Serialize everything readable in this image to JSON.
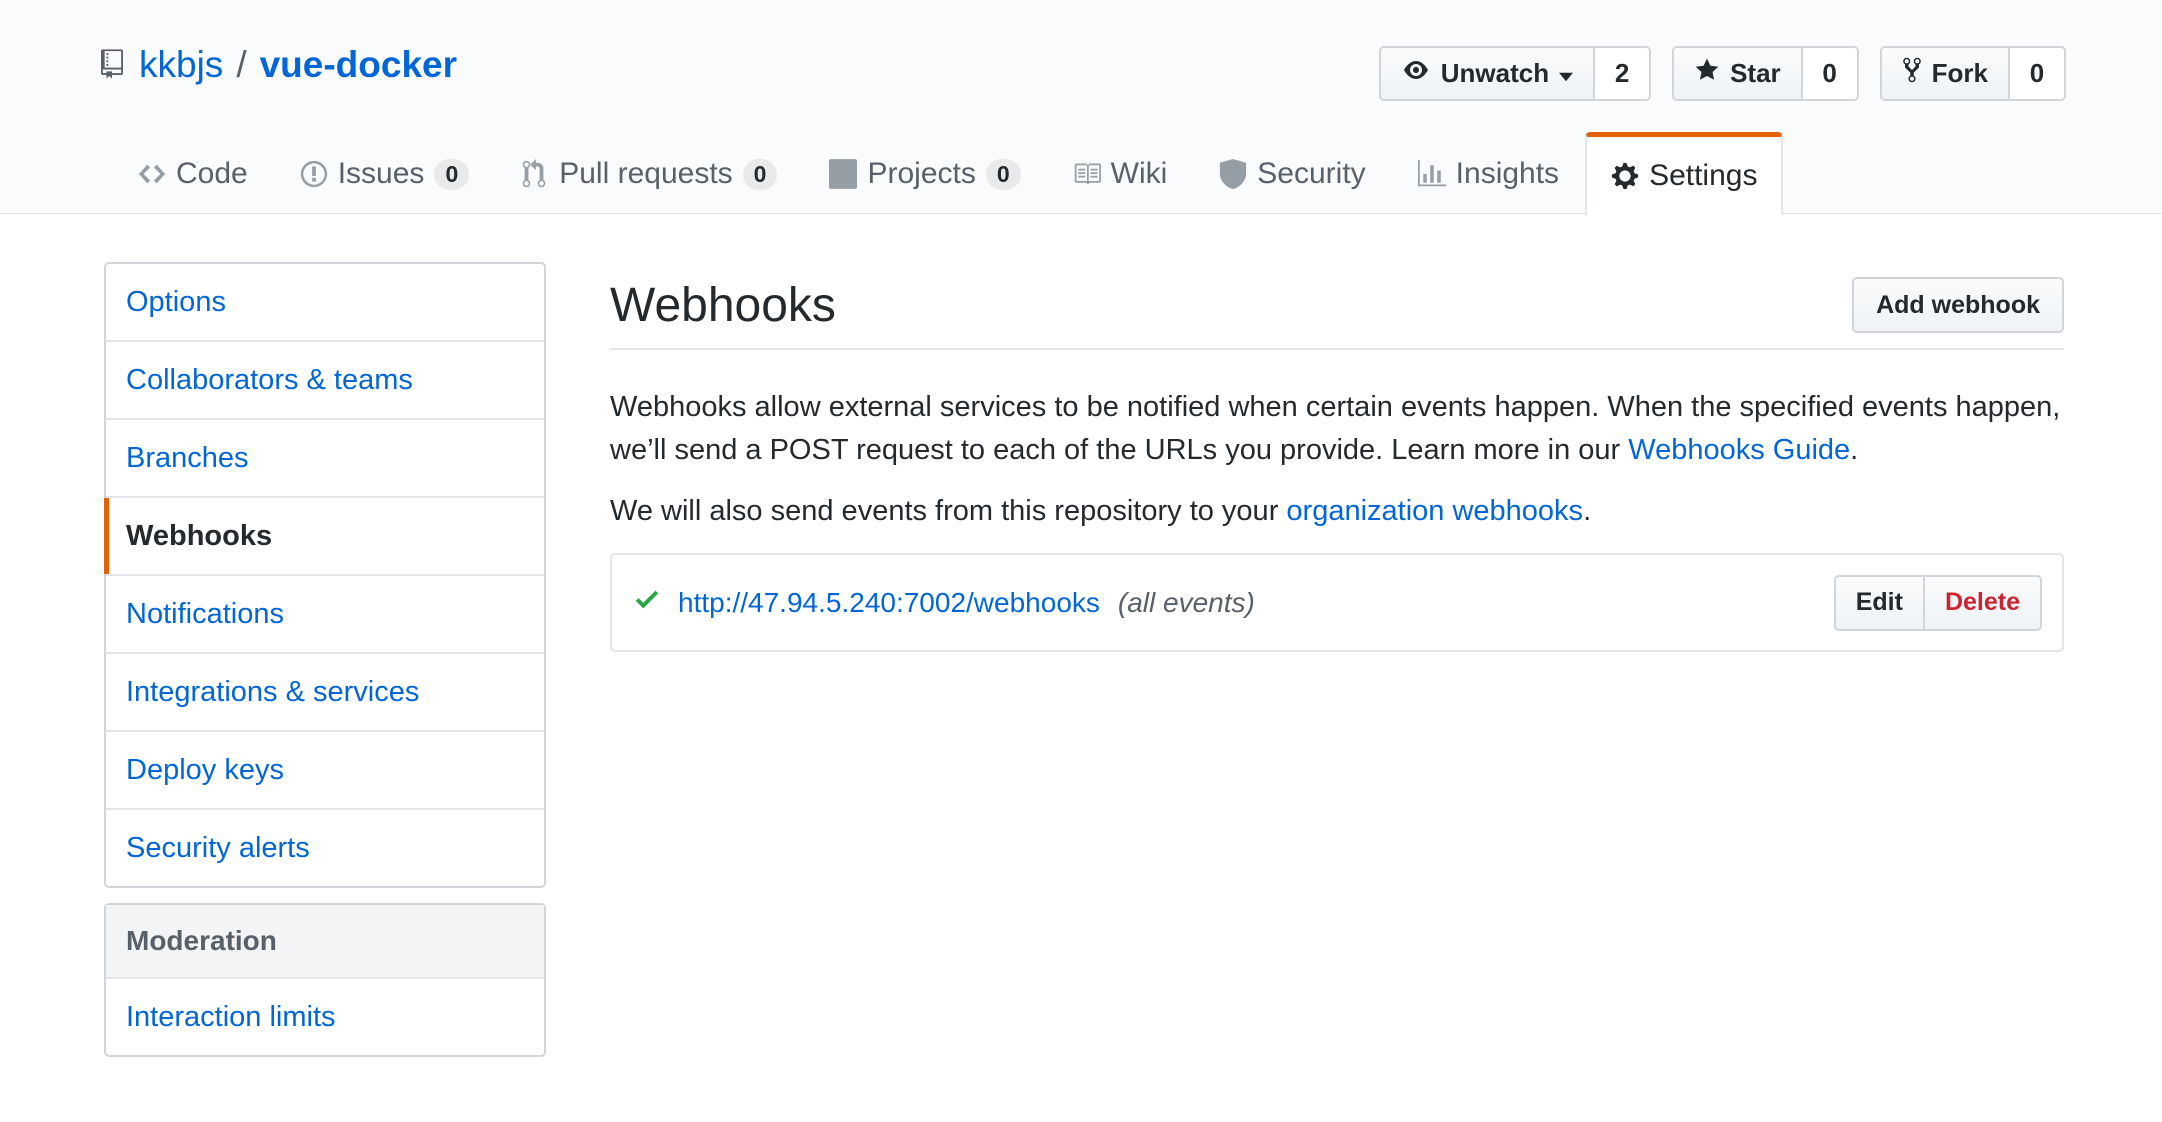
{
  "repo": {
    "owner": "kkbjs",
    "separator": "/",
    "name": "vue-docker"
  },
  "actions": {
    "watch": {
      "label": "Unwatch",
      "count": "2"
    },
    "star": {
      "label": "Star",
      "count": "0"
    },
    "fork": {
      "label": "Fork",
      "count": "0"
    }
  },
  "tabs": [
    {
      "label": "Code",
      "counter": ""
    },
    {
      "label": "Issues",
      "counter": "0"
    },
    {
      "label": "Pull requests",
      "counter": "0"
    },
    {
      "label": "Projects",
      "counter": "0"
    },
    {
      "label": "Wiki",
      "counter": ""
    },
    {
      "label": "Security",
      "counter": ""
    },
    {
      "label": "Insights",
      "counter": ""
    },
    {
      "label": "Settings",
      "counter": "",
      "selected": true
    }
  ],
  "sidebar": {
    "items": [
      {
        "label": "Options"
      },
      {
        "label": "Collaborators & teams"
      },
      {
        "label": "Branches"
      },
      {
        "label": "Webhooks",
        "selected": true
      },
      {
        "label": "Notifications"
      },
      {
        "label": "Integrations & services"
      },
      {
        "label": "Deploy keys"
      },
      {
        "label": "Security alerts"
      }
    ],
    "moderation": {
      "heading": "Moderation",
      "items": [
        {
          "label": "Interaction limits"
        }
      ]
    }
  },
  "main": {
    "title": "Webhooks",
    "add_button": "Add webhook",
    "desc_part1": "Webhooks allow external services to be notified when certain events happen. When the specified events happen, we’ll send a POST request to each of the URLs you provide. Learn more in our ",
    "desc_link": "Webhooks Guide",
    "desc_end": ".",
    "org_part1": "We will also send events from this repository to your ",
    "org_link": "organization webhooks",
    "org_end": ".",
    "hook": {
      "url": "http://47.94.5.240:7002/webhooks",
      "events": "(all events)",
      "edit_label": "Edit",
      "delete_label": "Delete"
    }
  },
  "colors": {
    "accent": "#e36209",
    "link": "#0366d6",
    "success": "#28a745",
    "danger": "#cb2431"
  }
}
